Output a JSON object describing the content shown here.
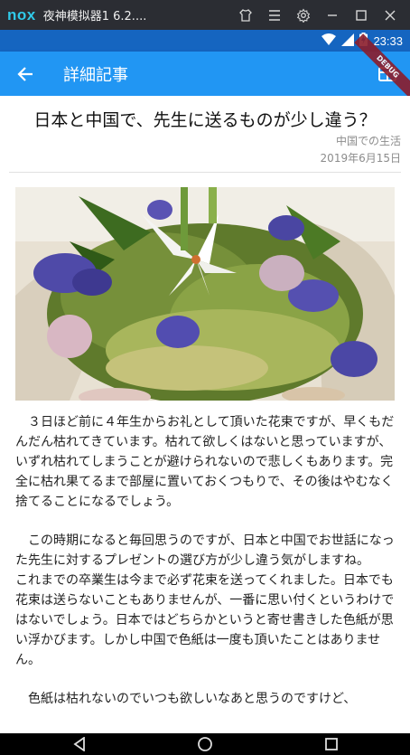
{
  "emulator": {
    "logo": "nox",
    "title": "夜神模拟器1 6.2....",
    "tools": [
      "shirt-icon",
      "menu-icon",
      "gear-icon",
      "minimize-icon",
      "maximize-icon",
      "close-icon"
    ]
  },
  "status_bar": {
    "time": "23:33",
    "icons": [
      "wifi-icon",
      "signal-icon",
      "battery-charging-icon"
    ]
  },
  "app_bar": {
    "title": "詳細記事",
    "back_icon": "arrow-back-icon",
    "action_icon": "view-layout-icon",
    "debug_banner": "DEBUG"
  },
  "article": {
    "title": "日本と中国で、先生に送るものが少し違う？",
    "category": "中国での生活",
    "date": "2019年6月15日",
    "image": "flower-bouquet-photo",
    "paragraphs": [
      "　３日ほど前に４年生からお礼として頂いた花束ですが、早くもだんだん枯れてきています。枯れて欲しくはないと思っていますが、いずれ枯れてしまうことが避けられないので悲しくもあります。完全に枯れ果てるまで部屋に置いておくつもりで、その後はやむなく捨てることになるでしょう。",
      "　この時期になると毎回思うのですが、日本と中国でお世話になった先生に対するプレゼントの選び方が少し違う気がしますね。\nこれまでの卒業生は今まで必ず花束を送ってくれました。日本でも花束は送らないこともありませんが、一番に思い付くというわけではないでしょう。日本ではどちらかというと寄せ書きした色紙が思い浮かびます。しかし中国で色紙は一度も頂いたことはありません。",
      "　色紙は枯れないのでいつも欲しいなあと思うのですけど、"
    ]
  },
  "nav_bar": {
    "buttons": [
      "back-triangle-icon",
      "home-circle-icon",
      "recents-square-icon"
    ]
  }
}
